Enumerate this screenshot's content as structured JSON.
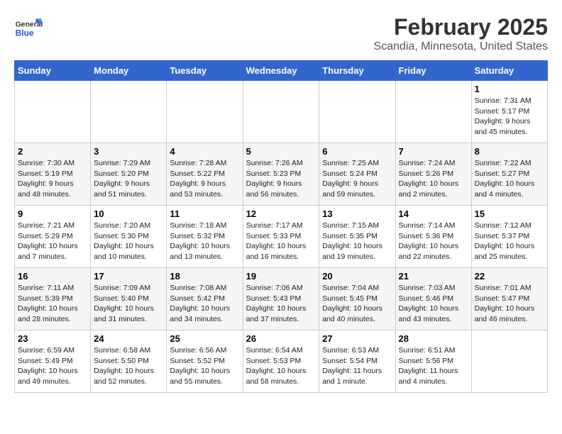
{
  "header": {
    "logo_general": "General",
    "logo_blue": "Blue",
    "month_title": "February 2025",
    "location": "Scandia, Minnesota, United States"
  },
  "days_of_week": [
    "Sunday",
    "Monday",
    "Tuesday",
    "Wednesday",
    "Thursday",
    "Friday",
    "Saturday"
  ],
  "weeks": [
    [
      {
        "day": "",
        "info": ""
      },
      {
        "day": "",
        "info": ""
      },
      {
        "day": "",
        "info": ""
      },
      {
        "day": "",
        "info": ""
      },
      {
        "day": "",
        "info": ""
      },
      {
        "day": "",
        "info": ""
      },
      {
        "day": "1",
        "info": "Sunrise: 7:31 AM\nSunset: 5:17 PM\nDaylight: 9 hours and 45 minutes."
      }
    ],
    [
      {
        "day": "2",
        "info": "Sunrise: 7:30 AM\nSunset: 5:19 PM\nDaylight: 9 hours and 48 minutes."
      },
      {
        "day": "3",
        "info": "Sunrise: 7:29 AM\nSunset: 5:20 PM\nDaylight: 9 hours and 51 minutes."
      },
      {
        "day": "4",
        "info": "Sunrise: 7:28 AM\nSunset: 5:22 PM\nDaylight: 9 hours and 53 minutes."
      },
      {
        "day": "5",
        "info": "Sunrise: 7:26 AM\nSunset: 5:23 PM\nDaylight: 9 hours and 56 minutes."
      },
      {
        "day": "6",
        "info": "Sunrise: 7:25 AM\nSunset: 5:24 PM\nDaylight: 9 hours and 59 minutes."
      },
      {
        "day": "7",
        "info": "Sunrise: 7:24 AM\nSunset: 5:26 PM\nDaylight: 10 hours and 2 minutes."
      },
      {
        "day": "8",
        "info": "Sunrise: 7:22 AM\nSunset: 5:27 PM\nDaylight: 10 hours and 4 minutes."
      }
    ],
    [
      {
        "day": "9",
        "info": "Sunrise: 7:21 AM\nSunset: 5:29 PM\nDaylight: 10 hours and 7 minutes."
      },
      {
        "day": "10",
        "info": "Sunrise: 7:20 AM\nSunset: 5:30 PM\nDaylight: 10 hours and 10 minutes."
      },
      {
        "day": "11",
        "info": "Sunrise: 7:18 AM\nSunset: 5:32 PM\nDaylight: 10 hours and 13 minutes."
      },
      {
        "day": "12",
        "info": "Sunrise: 7:17 AM\nSunset: 5:33 PM\nDaylight: 10 hours and 16 minutes."
      },
      {
        "day": "13",
        "info": "Sunrise: 7:15 AM\nSunset: 5:35 PM\nDaylight: 10 hours and 19 minutes."
      },
      {
        "day": "14",
        "info": "Sunrise: 7:14 AM\nSunset: 5:36 PM\nDaylight: 10 hours and 22 minutes."
      },
      {
        "day": "15",
        "info": "Sunrise: 7:12 AM\nSunset: 5:37 PM\nDaylight: 10 hours and 25 minutes."
      }
    ],
    [
      {
        "day": "16",
        "info": "Sunrise: 7:11 AM\nSunset: 5:39 PM\nDaylight: 10 hours and 28 minutes."
      },
      {
        "day": "17",
        "info": "Sunrise: 7:09 AM\nSunset: 5:40 PM\nDaylight: 10 hours and 31 minutes."
      },
      {
        "day": "18",
        "info": "Sunrise: 7:08 AM\nSunset: 5:42 PM\nDaylight: 10 hours and 34 minutes."
      },
      {
        "day": "19",
        "info": "Sunrise: 7:06 AM\nSunset: 5:43 PM\nDaylight: 10 hours and 37 minutes."
      },
      {
        "day": "20",
        "info": "Sunrise: 7:04 AM\nSunset: 5:45 PM\nDaylight: 10 hours and 40 minutes."
      },
      {
        "day": "21",
        "info": "Sunrise: 7:03 AM\nSunset: 5:46 PM\nDaylight: 10 hours and 43 minutes."
      },
      {
        "day": "22",
        "info": "Sunrise: 7:01 AM\nSunset: 5:47 PM\nDaylight: 10 hours and 46 minutes."
      }
    ],
    [
      {
        "day": "23",
        "info": "Sunrise: 6:59 AM\nSunset: 5:49 PM\nDaylight: 10 hours and 49 minutes."
      },
      {
        "day": "24",
        "info": "Sunrise: 6:58 AM\nSunset: 5:50 PM\nDaylight: 10 hours and 52 minutes."
      },
      {
        "day": "25",
        "info": "Sunrise: 6:56 AM\nSunset: 5:52 PM\nDaylight: 10 hours and 55 minutes."
      },
      {
        "day": "26",
        "info": "Sunrise: 6:54 AM\nSunset: 5:53 PM\nDaylight: 10 hours and 58 minutes."
      },
      {
        "day": "27",
        "info": "Sunrise: 6:53 AM\nSunset: 5:54 PM\nDaylight: 11 hours and 1 minute."
      },
      {
        "day": "28",
        "info": "Sunrise: 6:51 AM\nSunset: 5:56 PM\nDaylight: 11 hours and 4 minutes."
      },
      {
        "day": "",
        "info": ""
      }
    ]
  ]
}
